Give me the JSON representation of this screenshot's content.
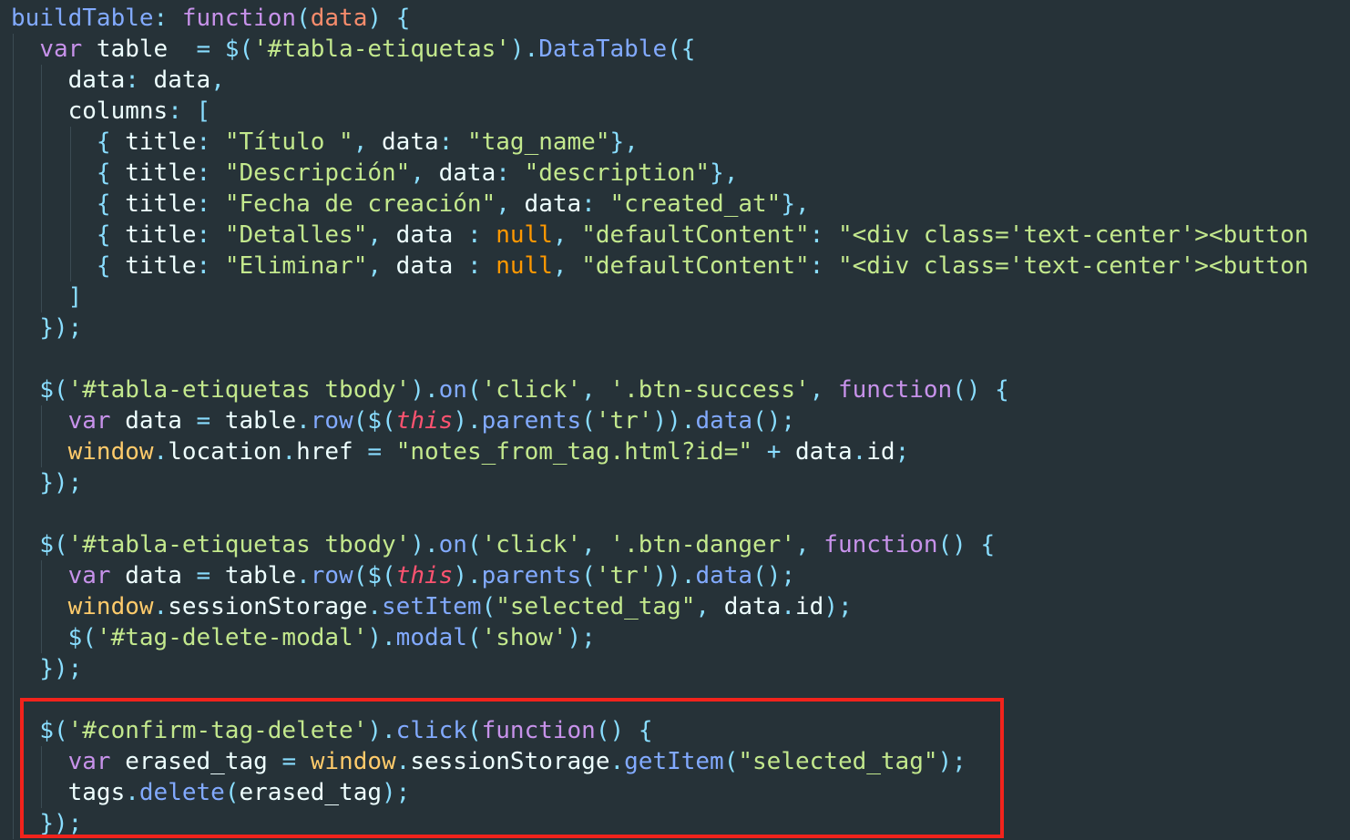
{
  "editor": {
    "theme_colors": {
      "background": "#263238",
      "highlight_box": "#f2231c"
    },
    "lines": [
      {
        "indent": 0,
        "tokens": [
          [
            "prop",
            "buildTable"
          ],
          [
            "punc",
            ":"
          ],
          [
            "plain",
            " "
          ],
          [
            "key",
            "function"
          ],
          [
            "punc",
            "("
          ],
          [
            "param",
            "data"
          ],
          [
            "punc",
            ")"
          ],
          [
            "plain",
            " "
          ],
          [
            "punc",
            "{"
          ]
        ]
      },
      {
        "indent": 1,
        "tokens": [
          [
            "key",
            "var"
          ],
          [
            "plain",
            " table  "
          ],
          [
            "op",
            "="
          ],
          [
            "plain",
            " "
          ],
          [
            "punc",
            "$("
          ],
          [
            "str",
            "'#tabla-etiquetas'"
          ],
          [
            "punc",
            ")."
          ],
          [
            "fn",
            "DataTable"
          ],
          [
            "punc",
            "({"
          ]
        ]
      },
      {
        "indent": 2,
        "tokens": [
          [
            "plain",
            "data"
          ],
          [
            "punc",
            ":"
          ],
          [
            "plain",
            " data"
          ],
          [
            "punc",
            ","
          ]
        ]
      },
      {
        "indent": 2,
        "tokens": [
          [
            "plain",
            "columns"
          ],
          [
            "punc",
            ":"
          ],
          [
            "plain",
            " "
          ],
          [
            "punc",
            "["
          ]
        ]
      },
      {
        "indent": 3,
        "tokens": [
          [
            "punc",
            "{"
          ],
          [
            "plain",
            " title"
          ],
          [
            "punc",
            ":"
          ],
          [
            "plain",
            " "
          ],
          [
            "str",
            "\"Título \""
          ],
          [
            "punc",
            ","
          ],
          [
            "plain",
            " data"
          ],
          [
            "punc",
            ":"
          ],
          [
            "plain",
            " "
          ],
          [
            "str",
            "\"tag_name\""
          ],
          [
            "punc",
            "},"
          ]
        ]
      },
      {
        "indent": 3,
        "tokens": [
          [
            "punc",
            "{"
          ],
          [
            "plain",
            " title"
          ],
          [
            "punc",
            ":"
          ],
          [
            "plain",
            " "
          ],
          [
            "str",
            "\"Descripción\""
          ],
          [
            "punc",
            ","
          ],
          [
            "plain",
            " data"
          ],
          [
            "punc",
            ":"
          ],
          [
            "plain",
            " "
          ],
          [
            "str",
            "\"description\""
          ],
          [
            "punc",
            "},"
          ]
        ]
      },
      {
        "indent": 3,
        "tokens": [
          [
            "punc",
            "{"
          ],
          [
            "plain",
            " title"
          ],
          [
            "punc",
            ":"
          ],
          [
            "plain",
            " "
          ],
          [
            "str",
            "\"Fecha de creación\""
          ],
          [
            "punc",
            ","
          ],
          [
            "plain",
            " data"
          ],
          [
            "punc",
            ":"
          ],
          [
            "plain",
            " "
          ],
          [
            "str",
            "\"created_at\""
          ],
          [
            "punc",
            "},"
          ]
        ]
      },
      {
        "indent": 3,
        "tokens": [
          [
            "punc",
            "{"
          ],
          [
            "plain",
            " title"
          ],
          [
            "punc",
            ":"
          ],
          [
            "plain",
            " "
          ],
          [
            "str",
            "\"Detalles\""
          ],
          [
            "punc",
            ","
          ],
          [
            "plain",
            " data "
          ],
          [
            "punc",
            ":"
          ],
          [
            "plain",
            " "
          ],
          [
            "null",
            "null"
          ],
          [
            "punc",
            ","
          ],
          [
            "plain",
            " "
          ],
          [
            "str",
            "\"defaultContent\""
          ],
          [
            "punc",
            ":"
          ],
          [
            "plain",
            " "
          ],
          [
            "str",
            "\"<div class='text-center'><button"
          ]
        ]
      },
      {
        "indent": 3,
        "tokens": [
          [
            "punc",
            "{"
          ],
          [
            "plain",
            " title"
          ],
          [
            "punc",
            ":"
          ],
          [
            "plain",
            " "
          ],
          [
            "str",
            "\"Eliminar\""
          ],
          [
            "punc",
            ","
          ],
          [
            "plain",
            " data "
          ],
          [
            "punc",
            ":"
          ],
          [
            "plain",
            " "
          ],
          [
            "null",
            "null"
          ],
          [
            "punc",
            ","
          ],
          [
            "plain",
            " "
          ],
          [
            "str",
            "\"defaultContent\""
          ],
          [
            "punc",
            ":"
          ],
          [
            "plain",
            " "
          ],
          [
            "str",
            "\"<div class='text-center'><button"
          ]
        ]
      },
      {
        "indent": 2,
        "tokens": [
          [
            "punc",
            "]"
          ]
        ]
      },
      {
        "indent": 1,
        "tokens": [
          [
            "punc",
            "});"
          ]
        ]
      },
      {
        "indent": 1,
        "tokens": []
      },
      {
        "indent": 1,
        "tokens": [
          [
            "punc",
            "$("
          ],
          [
            "str",
            "'#tabla-etiquetas tbody'"
          ],
          [
            "punc",
            ")."
          ],
          [
            "fn",
            "on"
          ],
          [
            "punc",
            "("
          ],
          [
            "str",
            "'click'"
          ],
          [
            "punc",
            ","
          ],
          [
            "plain",
            " "
          ],
          [
            "str",
            "'.btn-success'"
          ],
          [
            "punc",
            ","
          ],
          [
            "plain",
            " "
          ],
          [
            "key",
            "function"
          ],
          [
            "punc",
            "()"
          ],
          [
            "plain",
            " "
          ],
          [
            "punc",
            "{"
          ]
        ]
      },
      {
        "indent": 2,
        "tokens": [
          [
            "key",
            "var"
          ],
          [
            "plain",
            " data "
          ],
          [
            "op",
            "="
          ],
          [
            "plain",
            " table"
          ],
          [
            "punc",
            "."
          ],
          [
            "fn",
            "row"
          ],
          [
            "punc",
            "($("
          ],
          [
            "this",
            "this"
          ],
          [
            "punc",
            ")."
          ],
          [
            "fn",
            "parents"
          ],
          [
            "punc",
            "("
          ],
          [
            "str",
            "'tr'"
          ],
          [
            "punc",
            "))."
          ],
          [
            "fn",
            "data"
          ],
          [
            "punc",
            "();"
          ]
        ]
      },
      {
        "indent": 2,
        "tokens": [
          [
            "win",
            "window"
          ],
          [
            "punc",
            "."
          ],
          [
            "plain",
            "location"
          ],
          [
            "punc",
            "."
          ],
          [
            "plain",
            "href "
          ],
          [
            "op",
            "="
          ],
          [
            "plain",
            " "
          ],
          [
            "str",
            "\"notes_from_tag.html?id=\""
          ],
          [
            "plain",
            " "
          ],
          [
            "op",
            "+"
          ],
          [
            "plain",
            " data"
          ],
          [
            "punc",
            "."
          ],
          [
            "plain",
            "id"
          ],
          [
            "punc",
            ";"
          ]
        ]
      },
      {
        "indent": 1,
        "tokens": [
          [
            "punc",
            "});"
          ]
        ]
      },
      {
        "indent": 1,
        "tokens": []
      },
      {
        "indent": 1,
        "tokens": [
          [
            "punc",
            "$("
          ],
          [
            "str",
            "'#tabla-etiquetas tbody'"
          ],
          [
            "punc",
            ")."
          ],
          [
            "fn",
            "on"
          ],
          [
            "punc",
            "("
          ],
          [
            "str",
            "'click'"
          ],
          [
            "punc",
            ","
          ],
          [
            "plain",
            " "
          ],
          [
            "str",
            "'.btn-danger'"
          ],
          [
            "punc",
            ","
          ],
          [
            "plain",
            " "
          ],
          [
            "key",
            "function"
          ],
          [
            "punc",
            "()"
          ],
          [
            "plain",
            " "
          ],
          [
            "punc",
            "{"
          ]
        ]
      },
      {
        "indent": 2,
        "tokens": [
          [
            "key",
            "var"
          ],
          [
            "plain",
            " data "
          ],
          [
            "op",
            "="
          ],
          [
            "plain",
            " table"
          ],
          [
            "punc",
            "."
          ],
          [
            "fn",
            "row"
          ],
          [
            "punc",
            "($("
          ],
          [
            "this",
            "this"
          ],
          [
            "punc",
            ")."
          ],
          [
            "fn",
            "parents"
          ],
          [
            "punc",
            "("
          ],
          [
            "str",
            "'tr'"
          ],
          [
            "punc",
            "))."
          ],
          [
            "fn",
            "data"
          ],
          [
            "punc",
            "();"
          ]
        ]
      },
      {
        "indent": 2,
        "tokens": [
          [
            "win",
            "window"
          ],
          [
            "punc",
            "."
          ],
          [
            "plain",
            "sessionStorage"
          ],
          [
            "punc",
            "."
          ],
          [
            "fn",
            "setItem"
          ],
          [
            "punc",
            "("
          ],
          [
            "str",
            "\"selected_tag\""
          ],
          [
            "punc",
            ","
          ],
          [
            "plain",
            " data"
          ],
          [
            "punc",
            "."
          ],
          [
            "plain",
            "id"
          ],
          [
            "punc",
            ");"
          ]
        ]
      },
      {
        "indent": 2,
        "tokens": [
          [
            "punc",
            "$("
          ],
          [
            "str",
            "'#tag-delete-modal'"
          ],
          [
            "punc",
            ")."
          ],
          [
            "fn",
            "modal"
          ],
          [
            "punc",
            "("
          ],
          [
            "str",
            "'show'"
          ],
          [
            "punc",
            ");"
          ]
        ]
      },
      {
        "indent": 1,
        "tokens": [
          [
            "punc",
            "});"
          ]
        ]
      },
      {
        "indent": 1,
        "tokens": []
      },
      {
        "indent": 1,
        "tokens": [
          [
            "punc",
            "$("
          ],
          [
            "str",
            "'#confirm-tag-delete'"
          ],
          [
            "punc",
            ")."
          ],
          [
            "fn",
            "click"
          ],
          [
            "punc",
            "("
          ],
          [
            "key",
            "function"
          ],
          [
            "punc",
            "()"
          ],
          [
            "plain",
            " "
          ],
          [
            "punc",
            "{"
          ]
        ]
      },
      {
        "indent": 2,
        "tokens": [
          [
            "key",
            "var"
          ],
          [
            "plain",
            " erased_tag "
          ],
          [
            "op",
            "="
          ],
          [
            "plain",
            " "
          ],
          [
            "win",
            "window"
          ],
          [
            "punc",
            "."
          ],
          [
            "plain",
            "sessionStorage"
          ],
          [
            "punc",
            "."
          ],
          [
            "fn",
            "getItem"
          ],
          [
            "punc",
            "("
          ],
          [
            "str",
            "\"selected_tag\""
          ],
          [
            "punc",
            ");"
          ]
        ]
      },
      {
        "indent": 2,
        "tokens": [
          [
            "plain",
            "tags"
          ],
          [
            "punc",
            "."
          ],
          [
            "fn",
            "delete"
          ],
          [
            "punc",
            "("
          ],
          [
            "plain",
            "erased_tag"
          ],
          [
            "punc",
            ");"
          ]
        ]
      },
      {
        "indent": 1,
        "tokens": [
          [
            "punc",
            "});"
          ]
        ]
      }
    ]
  }
}
